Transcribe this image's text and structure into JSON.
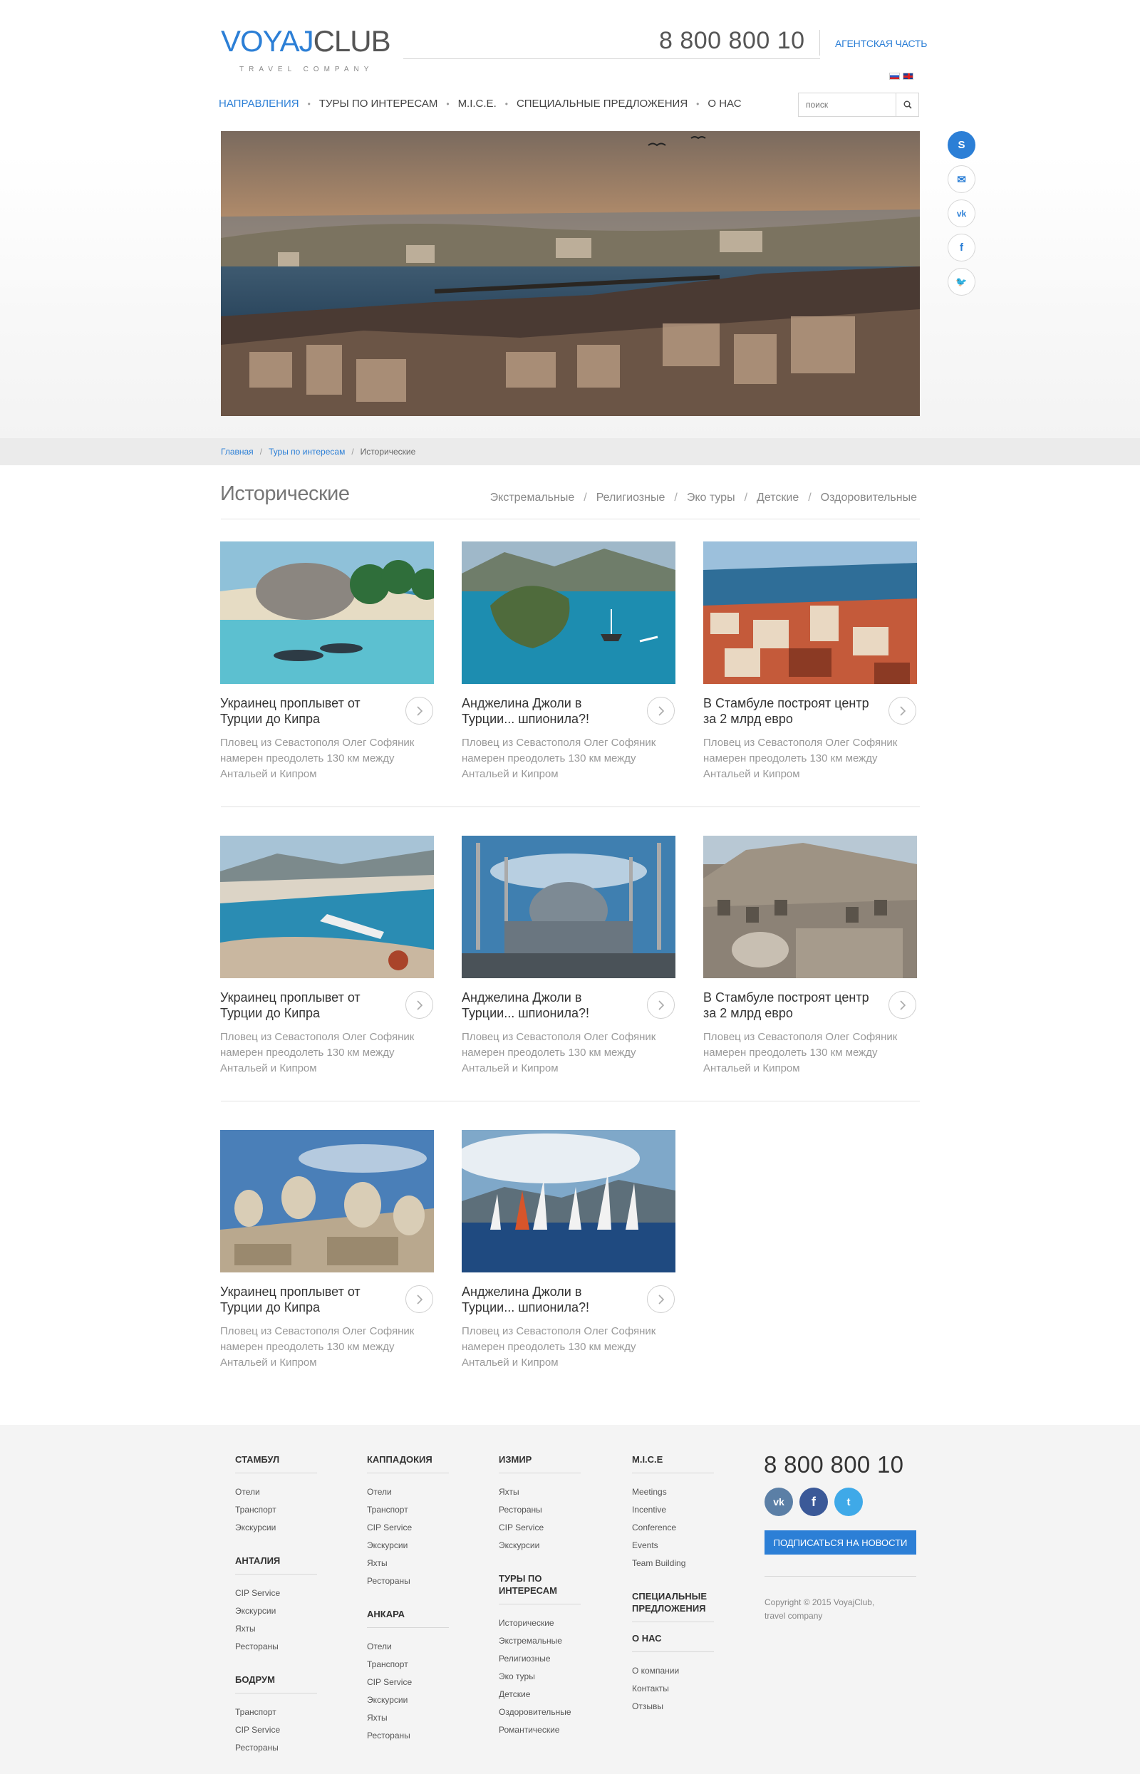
{
  "header": {
    "logo_a": "VOYAJ",
    "logo_b": "CLUB",
    "tagline": "travel company",
    "phone": "8 800 800 10",
    "agency_link": "Агентская часть",
    "languages": [
      "ru",
      "en"
    ]
  },
  "nav": {
    "items": [
      {
        "label": "Направления",
        "active": true
      },
      {
        "label": "Туры по интересам",
        "active": false
      },
      {
        "label": "M.I.C.E.",
        "active": false
      },
      {
        "label": "Специальные предложения",
        "active": false
      },
      {
        "label": "О нас",
        "active": false
      }
    ]
  },
  "search": {
    "placeholder": "поиск"
  },
  "social_side": [
    "skype-icon",
    "mail-icon",
    "vk-icon",
    "facebook-icon",
    "twitter-icon"
  ],
  "breadcrumb": {
    "home": "Главная",
    "parent": "Туры по интересам",
    "current": "Исторические"
  },
  "section": {
    "title": "Исторические",
    "subcategories": [
      "Экстремальные",
      "Религиозные",
      "Эко туры",
      "Детские",
      "Оздоровительные"
    ]
  },
  "cards": [
    {
      "title": "Украинец проплывет от Турции до Кипра",
      "desc": "Пловец из Севастополя Олег Софяник намерен преодолеть 130 км между Антальей и Кипром",
      "image": "beach-snorkel"
    },
    {
      "title": "Анджелина Джоли в Турции... шпионила?!",
      "desc": "Пловец из Севастополя Олег Софяник намерен преодолеть 130 км между Антальей и Кипром",
      "image": "bay-island-yacht"
    },
    {
      "title": "В Стамбуле построят центр за 2 млрд евро",
      "desc": "Пловец из Севастополя Олег Софяник намерен преодолеть 130 км между Антальей и Кипром",
      "image": "istanbul-rooftops"
    },
    {
      "title": "Украинец проплывет от Турции до Кипра",
      "desc": "Пловец из Севастополя Олег Софяник намерен преодолеть 130 км между Антальей и Кипром",
      "image": "alanya-coast"
    },
    {
      "title": "Анджелина Джоли в Турции... шпионила?!",
      "desc": "Пловец из Севастополя Олег Софяник намерен преодолеть 130 км между Антальей и Кипром",
      "image": "blue-mosque"
    },
    {
      "title": "В Стамбуле построят центр за 2 млрд евро",
      "desc": "Пловец из Севастополя Олег Софяник намерен преодолеть 130 км между Антальей и Кипром",
      "image": "stone-city"
    },
    {
      "title": "Украинец проплывет от Турции до Кипра",
      "desc": "Пловец из Севастополя Олег Софяник намерен преодолеть 130 км между Антальей и Кипром",
      "image": "nemrut-heads"
    },
    {
      "title": "Анджелина Джоли в Турции... шпионила?!",
      "desc": "Пловец из Севастополя Олег Софяник намерен преодолеть 130 км между Антальей и Кипром",
      "image": "sailboats"
    }
  ],
  "footer": {
    "col1": [
      {
        "heading": "Стамбул",
        "links": [
          "Отели",
          "Транспорт",
          "Экскурсии"
        ]
      },
      {
        "heading": "Анталия",
        "links": [
          "CIP Service",
          "Экскурсии",
          "Яхты",
          "Рестораны"
        ]
      },
      {
        "heading": "Бодрум",
        "links": [
          "Транспорт",
          "CIP Service",
          "Рестораны"
        ]
      }
    ],
    "col2": [
      {
        "heading": "Каппадокия",
        "links": [
          "Отели",
          "Транспорт",
          "CIP Service",
          "Экскурсии",
          "Яхты",
          "Рестораны"
        ]
      },
      {
        "heading": "Анкара",
        "links": [
          "Отели",
          "Транспорт",
          "CIP Service",
          "Экскурсии",
          "Яхты",
          "Рестораны"
        ]
      }
    ],
    "col3": [
      {
        "heading": "Измир",
        "links": [
          "Яхты",
          "Рестораны",
          "CIP Service",
          "Экскурсии"
        ]
      },
      {
        "heading": "Туры по интересам",
        "links": [
          "Исторические",
          "Экстремальные",
          "Религиозные",
          "Эко туры",
          "Детские",
          "Оздоровительные",
          "Романтические"
        ]
      }
    ],
    "col4": [
      {
        "heading": "M.I.C.E",
        "links": [
          "Meetings",
          "Incentive",
          "Conference",
          "Events",
          "Team Building"
        ]
      },
      {
        "heading": "Специальные предложения",
        "links": []
      },
      {
        "heading": "О нас",
        "links": [
          "О компании",
          "Контакты",
          "Отзывы"
        ]
      }
    ],
    "phone": "8 800 800 10",
    "social": [
      "vk-icon",
      "facebook-icon",
      "twitter-icon"
    ],
    "subscribe_label": "Подписаться на новости",
    "copyright_1": "Copyright © 2015 VoyajClub,",
    "copyright_2": "travel company"
  },
  "colors": {
    "accent": "#2c7fd6",
    "vk": "#5b7fa6",
    "facebook": "#3b5998",
    "twitter": "#3fa9e8"
  }
}
